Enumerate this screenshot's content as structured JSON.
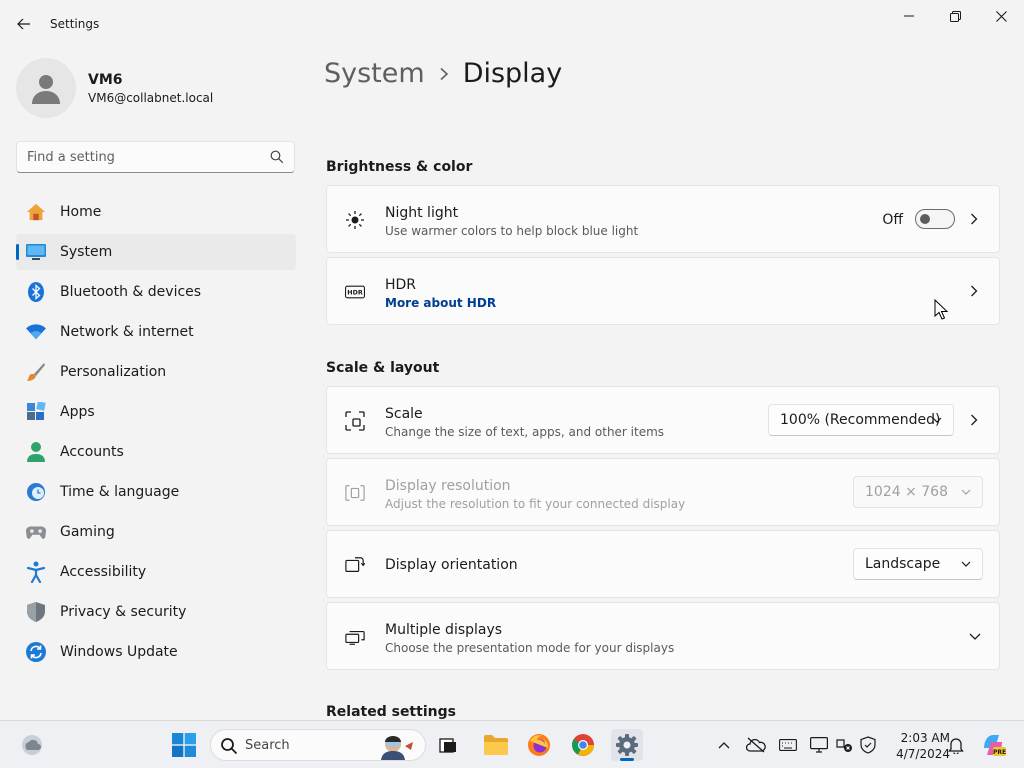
{
  "window": {
    "title": "Settings"
  },
  "profile": {
    "name": "VM6",
    "email": "VM6@collabnet.local"
  },
  "search": {
    "placeholder": "Find a setting"
  },
  "nav": {
    "items": [
      {
        "label": "Home",
        "icon": "home-icon"
      },
      {
        "label": "System",
        "icon": "system-icon",
        "active": true
      },
      {
        "label": "Bluetooth & devices",
        "icon": "bluetooth-icon"
      },
      {
        "label": "Network & internet",
        "icon": "wifi-icon"
      },
      {
        "label": "Personalization",
        "icon": "brush-icon"
      },
      {
        "label": "Apps",
        "icon": "apps-icon"
      },
      {
        "label": "Accounts",
        "icon": "accounts-icon"
      },
      {
        "label": "Time & language",
        "icon": "clock-globe-icon"
      },
      {
        "label": "Gaming",
        "icon": "gamepad-icon"
      },
      {
        "label": "Accessibility",
        "icon": "accessibility-icon"
      },
      {
        "label": "Privacy & security",
        "icon": "shield-icon"
      },
      {
        "label": "Windows Update",
        "icon": "update-icon"
      }
    ]
  },
  "breadcrumb": {
    "parent": "System",
    "current": "Display"
  },
  "sections": {
    "brightness": {
      "title": "Brightness & color",
      "night_light": {
        "title": "Night light",
        "subtitle": "Use warmer colors to help block blue light",
        "state_label": "Off"
      },
      "hdr": {
        "title": "HDR",
        "link": "More about HDR"
      }
    },
    "scale_layout": {
      "title": "Scale & layout",
      "scale": {
        "title": "Scale",
        "subtitle": "Change the size of text, apps, and other items",
        "value": "100% (Recommended)"
      },
      "resolution": {
        "title": "Display resolution",
        "subtitle": "Adjust the resolution to fit your connected display",
        "value": "1024 × 768"
      },
      "orientation": {
        "title": "Display orientation",
        "value": "Landscape"
      },
      "multiple": {
        "title": "Multiple displays",
        "subtitle": "Choose the presentation mode for your displays"
      }
    },
    "related": {
      "title": "Related settings"
    }
  },
  "taskbar": {
    "search_placeholder": "Search",
    "time": "2:03 AM",
    "date": "4/7/2024",
    "accent": "#0067c0"
  }
}
